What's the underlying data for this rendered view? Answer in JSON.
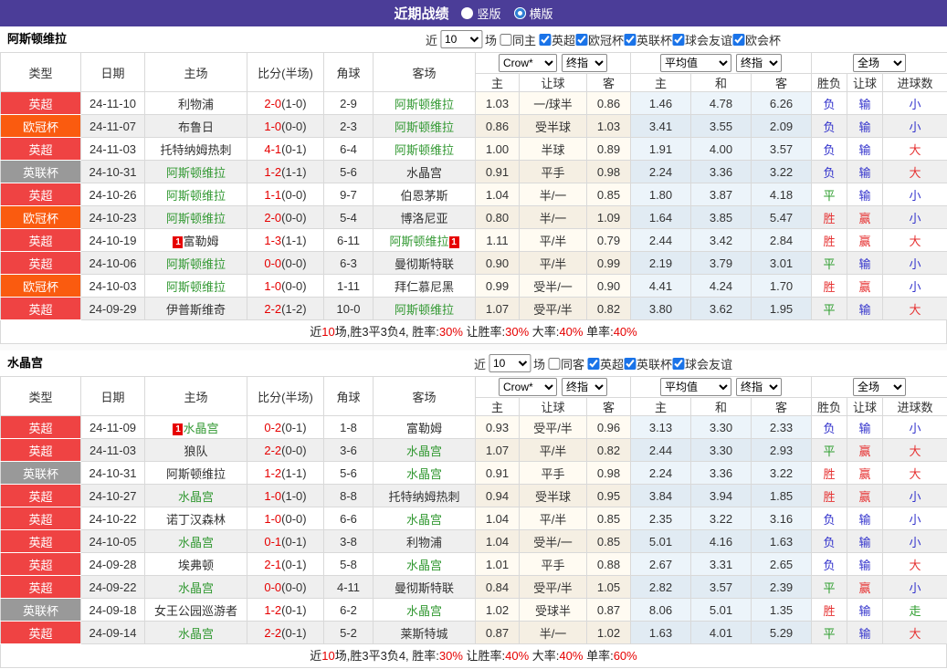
{
  "titlebar": {
    "title": "近期战绩",
    "layout_options": [
      {
        "label": "竖版",
        "selected": true
      },
      {
        "label": "横版",
        "selected": false
      }
    ]
  },
  "filter_labels": {
    "near": "近",
    "matches": "10",
    "games": "场"
  },
  "table_header": {
    "cols": [
      "类型",
      "日期",
      "主场",
      "比分(半场)",
      "角球",
      "客场"
    ],
    "sub": [
      "主",
      "让球",
      "客",
      "主",
      "和",
      "客",
      "胜负",
      "让球",
      "进球数"
    ],
    "selects": {
      "odds": "Crow*",
      "final1": "终指",
      "avg": "平均值",
      "final2": "终指",
      "scope": "全场"
    }
  },
  "colors": {
    "header_purple": "#4b3d98",
    "league_premier": "#ef4343",
    "league_ucl": "#fa5b0f",
    "league_efl": "#999999",
    "team_green": "#339933",
    "score_red": "#e60000",
    "win_red": "#e63333",
    "draw_green": "#2e9e2e",
    "lose_blue": "#3333cc"
  },
  "sections": [
    {
      "team": "阿斯顿维拉",
      "same_label": "同主",
      "leagues": [
        "英超",
        "欧冠杯",
        "英联杯",
        "球会友谊",
        "欧会杯"
      ],
      "rows": [
        {
          "lg": "英超",
          "lc": "red",
          "date": "24-11-10",
          "home": "利物浦",
          "hg": false,
          "hc": "",
          "score": "2-0",
          "half": "(1-0)",
          "corner": "2-9",
          "away": "阿斯顿维拉",
          "ag": true,
          "ac": "",
          "odds": [
            "1.03",
            "一/球半",
            "0.86"
          ],
          "avg": [
            "1.46",
            "4.78",
            "6.26"
          ],
          "res": [
            [
              "负",
              "b"
            ],
            [
              "输",
              "b"
            ],
            [
              "小",
              "b"
            ]
          ]
        },
        {
          "lg": "欧冠杯",
          "lc": "orange",
          "date": "24-11-07",
          "home": "布鲁日",
          "hg": false,
          "hc": "",
          "score": "1-0",
          "half": "(0-0)",
          "corner": "2-3",
          "away": "阿斯顿维拉",
          "ag": true,
          "ac": "",
          "odds": [
            "0.86",
            "受半球",
            "1.03"
          ],
          "avg": [
            "3.41",
            "3.55",
            "2.09"
          ],
          "res": [
            [
              "负",
              "b"
            ],
            [
              "输",
              "b"
            ],
            [
              "小",
              "b"
            ]
          ]
        },
        {
          "lg": "英超",
          "lc": "red",
          "date": "24-11-03",
          "home": "托特纳姆热刺",
          "hg": false,
          "hc": "",
          "score": "4-1",
          "half": "(0-1)",
          "corner": "6-4",
          "away": "阿斯顿维拉",
          "ag": true,
          "ac": "",
          "odds": [
            "1.00",
            "半球",
            "0.89"
          ],
          "avg": [
            "1.91",
            "4.00",
            "3.57"
          ],
          "res": [
            [
              "负",
              "b"
            ],
            [
              "输",
              "b"
            ],
            [
              "大",
              "r"
            ]
          ]
        },
        {
          "lg": "英联杯",
          "lc": "gray",
          "date": "24-10-31",
          "home": "阿斯顿维拉",
          "hg": true,
          "hc": "",
          "score": "1-2",
          "half": "(1-1)",
          "corner": "5-6",
          "away": "水晶宫",
          "ag": false,
          "ac": "",
          "odds": [
            "0.91",
            "平手",
            "0.98"
          ],
          "avg": [
            "2.24",
            "3.36",
            "3.22"
          ],
          "res": [
            [
              "负",
              "b"
            ],
            [
              "输",
              "b"
            ],
            [
              "大",
              "r"
            ]
          ]
        },
        {
          "lg": "英超",
          "lc": "red",
          "date": "24-10-26",
          "home": "阿斯顿维拉",
          "hg": true,
          "hc": "",
          "score": "1-1",
          "half": "(0-0)",
          "corner": "9-7",
          "away": "伯恩茅斯",
          "ag": false,
          "ac": "",
          "odds": [
            "1.04",
            "半/一",
            "0.85"
          ],
          "avg": [
            "1.80",
            "3.87",
            "4.18"
          ],
          "res": [
            [
              "平",
              "g"
            ],
            [
              "输",
              "b"
            ],
            [
              "小",
              "b"
            ]
          ]
        },
        {
          "lg": "欧冠杯",
          "lc": "orange",
          "date": "24-10-23",
          "home": "阿斯顿维拉",
          "hg": true,
          "hc": "",
          "score": "2-0",
          "half": "(0-0)",
          "corner": "5-4",
          "away": "博洛尼亚",
          "ag": false,
          "ac": "",
          "odds": [
            "0.80",
            "半/一",
            "1.09"
          ],
          "avg": [
            "1.64",
            "3.85",
            "5.47"
          ],
          "res": [
            [
              "胜",
              "r"
            ],
            [
              "赢",
              "r"
            ],
            [
              "小",
              "b"
            ]
          ]
        },
        {
          "lg": "英超",
          "lc": "red",
          "date": "24-10-19",
          "home": "富勒姆",
          "hg": false,
          "hc": "1",
          "score": "1-3",
          "half": "(1-1)",
          "corner": "6-11",
          "away": "阿斯顿维拉",
          "ag": true,
          "ac": "1",
          "odds": [
            "1.11",
            "平/半",
            "0.79"
          ],
          "avg": [
            "2.44",
            "3.42",
            "2.84"
          ],
          "res": [
            [
              "胜",
              "r"
            ],
            [
              "赢",
              "r"
            ],
            [
              "大",
              "r"
            ]
          ]
        },
        {
          "lg": "英超",
          "lc": "red",
          "date": "24-10-06",
          "home": "阿斯顿维拉",
          "hg": true,
          "hc": "",
          "score": "0-0",
          "half": "(0-0)",
          "corner": "6-3",
          "away": "曼彻斯特联",
          "ag": false,
          "ac": "",
          "odds": [
            "0.90",
            "平/半",
            "0.99"
          ],
          "avg": [
            "2.19",
            "3.79",
            "3.01"
          ],
          "res": [
            [
              "平",
              "g"
            ],
            [
              "输",
              "b"
            ],
            [
              "小",
              "b"
            ]
          ]
        },
        {
          "lg": "欧冠杯",
          "lc": "orange",
          "date": "24-10-03",
          "home": "阿斯顿维拉",
          "hg": true,
          "hc": "",
          "score": "1-0",
          "half": "(0-0)",
          "corner": "1-11",
          "away": "拜仁慕尼黑",
          "ag": false,
          "ac": "",
          "odds": [
            "0.99",
            "受半/一",
            "0.90"
          ],
          "avg": [
            "4.41",
            "4.24",
            "1.70"
          ],
          "res": [
            [
              "胜",
              "r"
            ],
            [
              "赢",
              "r"
            ],
            [
              "小",
              "b"
            ]
          ]
        },
        {
          "lg": "英超",
          "lc": "red",
          "date": "24-09-29",
          "home": "伊普斯维奇",
          "hg": false,
          "hc": "",
          "score": "2-2",
          "half": "(1-2)",
          "corner": "10-0",
          "away": "阿斯顿维拉",
          "ag": true,
          "ac": "",
          "odds": [
            "1.07",
            "受平/半",
            "0.82"
          ],
          "avg": [
            "3.80",
            "3.62",
            "1.95"
          ],
          "res": [
            [
              "平",
              "g"
            ],
            [
              "输",
              "b"
            ],
            [
              "大",
              "r"
            ]
          ]
        }
      ],
      "footer": [
        [
          "近",
          "k"
        ],
        [
          "10",
          "r"
        ],
        [
          "场,胜3平3负4, 胜率:",
          "k"
        ],
        [
          "30%",
          "r"
        ],
        [
          " 让胜率:",
          "k"
        ],
        [
          "30%",
          "r"
        ],
        [
          " 大率:",
          "k"
        ],
        [
          "40%",
          "r"
        ],
        [
          " 单率:",
          "k"
        ],
        [
          "40%",
          "r"
        ]
      ]
    },
    {
      "team": "水晶宫",
      "same_label": "同客",
      "leagues": [
        "英超",
        "英联杯",
        "球会友谊"
      ],
      "rows": [
        {
          "lg": "英超",
          "lc": "red",
          "date": "24-11-09",
          "home": "水晶宫",
          "hg": true,
          "hc": "1",
          "score": "0-2",
          "half": "(0-1)",
          "corner": "1-8",
          "away": "富勒姆",
          "ag": false,
          "ac": "",
          "odds": [
            "0.93",
            "受平/半",
            "0.96"
          ],
          "avg": [
            "3.13",
            "3.30",
            "2.33"
          ],
          "res": [
            [
              "负",
              "b"
            ],
            [
              "输",
              "b"
            ],
            [
              "小",
              "b"
            ]
          ]
        },
        {
          "lg": "英超",
          "lc": "red",
          "date": "24-11-03",
          "home": "狼队",
          "hg": false,
          "hc": "",
          "score": "2-2",
          "half": "(0-0)",
          "corner": "3-6",
          "away": "水晶宫",
          "ag": true,
          "ac": "",
          "odds": [
            "1.07",
            "平/半",
            "0.82"
          ],
          "avg": [
            "2.44",
            "3.30",
            "2.93"
          ],
          "res": [
            [
              "平",
              "g"
            ],
            [
              "赢",
              "r"
            ],
            [
              "大",
              "r"
            ]
          ]
        },
        {
          "lg": "英联杯",
          "lc": "gray",
          "date": "24-10-31",
          "home": "阿斯顿维拉",
          "hg": false,
          "hc": "",
          "score": "1-2",
          "half": "(1-1)",
          "corner": "5-6",
          "away": "水晶宫",
          "ag": true,
          "ac": "",
          "odds": [
            "0.91",
            "平手",
            "0.98"
          ],
          "avg": [
            "2.24",
            "3.36",
            "3.22"
          ],
          "res": [
            [
              "胜",
              "r"
            ],
            [
              "赢",
              "r"
            ],
            [
              "大",
              "r"
            ]
          ]
        },
        {
          "lg": "英超",
          "lc": "red",
          "date": "24-10-27",
          "home": "水晶宫",
          "hg": true,
          "hc": "",
          "score": "1-0",
          "half": "(1-0)",
          "corner": "8-8",
          "away": "托特纳姆热刺",
          "ag": false,
          "ac": "",
          "odds": [
            "0.94",
            "受半球",
            "0.95"
          ],
          "avg": [
            "3.84",
            "3.94",
            "1.85"
          ],
          "res": [
            [
              "胜",
              "r"
            ],
            [
              "赢",
              "r"
            ],
            [
              "小",
              "b"
            ]
          ]
        },
        {
          "lg": "英超",
          "lc": "red",
          "date": "24-10-22",
          "home": "诺丁汉森林",
          "hg": false,
          "hc": "",
          "score": "1-0",
          "half": "(0-0)",
          "corner": "6-6",
          "away": "水晶宫",
          "ag": true,
          "ac": "",
          "odds": [
            "1.04",
            "平/半",
            "0.85"
          ],
          "avg": [
            "2.35",
            "3.22",
            "3.16"
          ],
          "res": [
            [
              "负",
              "b"
            ],
            [
              "输",
              "b"
            ],
            [
              "小",
              "b"
            ]
          ]
        },
        {
          "lg": "英超",
          "lc": "red",
          "date": "24-10-05",
          "home": "水晶宫",
          "hg": true,
          "hc": "",
          "score": "0-1",
          "half": "(0-1)",
          "corner": "3-8",
          "away": "利物浦",
          "ag": false,
          "ac": "",
          "odds": [
            "1.04",
            "受半/一",
            "0.85"
          ],
          "avg": [
            "5.01",
            "4.16",
            "1.63"
          ],
          "res": [
            [
              "负",
              "b"
            ],
            [
              "输",
              "b"
            ],
            [
              "小",
              "b"
            ]
          ]
        },
        {
          "lg": "英超",
          "lc": "red",
          "date": "24-09-28",
          "home": "埃弗顿",
          "hg": false,
          "hc": "",
          "score": "2-1",
          "half": "(0-1)",
          "corner": "5-8",
          "away": "水晶宫",
          "ag": true,
          "ac": "",
          "odds": [
            "1.01",
            "平手",
            "0.88"
          ],
          "avg": [
            "2.67",
            "3.31",
            "2.65"
          ],
          "res": [
            [
              "负",
              "b"
            ],
            [
              "输",
              "b"
            ],
            [
              "大",
              "r"
            ]
          ]
        },
        {
          "lg": "英超",
          "lc": "red",
          "date": "24-09-22",
          "home": "水晶宫",
          "hg": true,
          "hc": "",
          "score": "0-0",
          "half": "(0-0)",
          "corner": "4-11",
          "away": "曼彻斯特联",
          "ag": false,
          "ac": "",
          "odds": [
            "0.84",
            "受平/半",
            "1.05"
          ],
          "avg": [
            "2.82",
            "3.57",
            "2.39"
          ],
          "res": [
            [
              "平",
              "g"
            ],
            [
              "赢",
              "r"
            ],
            [
              "小",
              "b"
            ]
          ]
        },
        {
          "lg": "英联杯",
          "lc": "gray",
          "date": "24-09-18",
          "home": "女王公园巡游者",
          "hg": false,
          "hc": "",
          "score": "1-2",
          "half": "(0-1)",
          "corner": "6-2",
          "away": "水晶宫",
          "ag": true,
          "ac": "",
          "odds": [
            "1.02",
            "受球半",
            "0.87"
          ],
          "avg": [
            "8.06",
            "5.01",
            "1.35"
          ],
          "res": [
            [
              "胜",
              "r"
            ],
            [
              "输",
              "b"
            ],
            [
              "走",
              "g"
            ]
          ]
        },
        {
          "lg": "英超",
          "lc": "red",
          "date": "24-09-14",
          "home": "水晶宫",
          "hg": true,
          "hc": "",
          "score": "2-2",
          "half": "(0-1)",
          "corner": "5-2",
          "away": "莱斯特城",
          "ag": false,
          "ac": "",
          "odds": [
            "0.87",
            "半/一",
            "1.02"
          ],
          "avg": [
            "1.63",
            "4.01",
            "5.29"
          ],
          "res": [
            [
              "平",
              "g"
            ],
            [
              "输",
              "b"
            ],
            [
              "大",
              "r"
            ]
          ]
        }
      ],
      "footer": [
        [
          "近",
          "k"
        ],
        [
          "10",
          "r"
        ],
        [
          "场,胜3平3负4, 胜率:",
          "k"
        ],
        [
          "30%",
          "r"
        ],
        [
          " 让胜率:",
          "k"
        ],
        [
          "40%",
          "r"
        ],
        [
          " 大率:",
          "k"
        ],
        [
          "40%",
          "r"
        ],
        [
          " 单率:",
          "k"
        ],
        [
          "60%",
          "r"
        ]
      ]
    }
  ]
}
